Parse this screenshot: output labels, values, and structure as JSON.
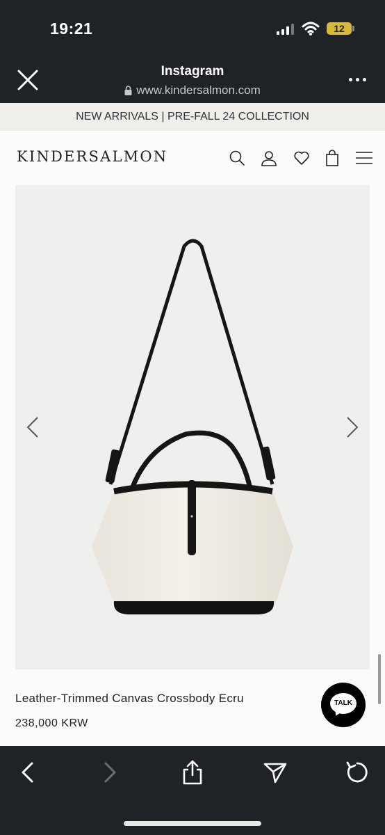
{
  "status": {
    "time": "19:21",
    "battery": "12",
    "icons": [
      "signal-icon",
      "wifi-icon",
      "battery-icon"
    ]
  },
  "browser": {
    "title": "Instagram",
    "url": "www.kindersalmon.com",
    "icons": [
      "close-icon",
      "lock-icon",
      "more-icon"
    ]
  },
  "promo": {
    "text": "NEW ARRIVALS | PRE-FALL 24 COLLECTION"
  },
  "header": {
    "logo": "KINDERSALMON",
    "icons": [
      "search-icon",
      "account-icon",
      "wishlist-heart-icon",
      "shopping-bag-icon",
      "menu-icon"
    ]
  },
  "product": {
    "image": "product-photo-canvas-bag",
    "name": "Leather-Trimmed Canvas Crossbody Ecru",
    "price": "238,000 KRW"
  },
  "chat": {
    "label": "TALK"
  },
  "bottom_nav": {
    "icons": [
      "back-icon",
      "forward-icon",
      "share-icon",
      "send-icon",
      "reload-icon"
    ]
  },
  "colors": {
    "bar_bg": "#1f2327",
    "page_bg": "#fbfbf9",
    "promo_bg": "#efeeeb",
    "battery": "#d9b93a"
  }
}
